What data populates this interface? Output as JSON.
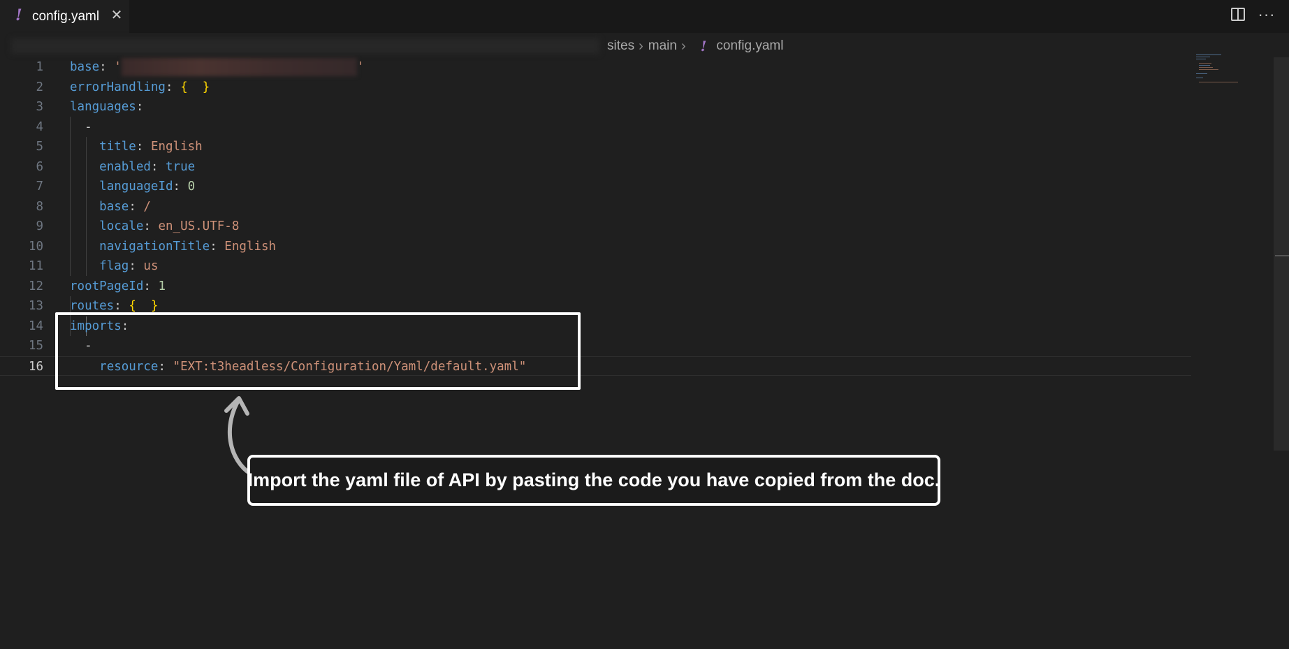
{
  "tab": {
    "icon": "yaml-file-icon",
    "label": "config.yaml",
    "close": "✕"
  },
  "toolbar": {
    "split_icon": "split-editor-icon",
    "more": "···"
  },
  "breadcrumb": {
    "items": [
      "sites",
      "main"
    ],
    "file": "config.yaml",
    "separator": "›"
  },
  "editor": {
    "active_line": 16,
    "lines": [
      {
        "num": "1"
      },
      {
        "num": "2"
      },
      {
        "num": "3"
      },
      {
        "num": "4"
      },
      {
        "num": "5"
      },
      {
        "num": "6"
      },
      {
        "num": "7"
      },
      {
        "num": "8"
      },
      {
        "num": "9"
      },
      {
        "num": "10"
      },
      {
        "num": "11"
      },
      {
        "num": "12"
      },
      {
        "num": "13"
      },
      {
        "num": "14"
      },
      {
        "num": "15"
      },
      {
        "num": "16"
      }
    ],
    "tokens": {
      "base": "base",
      "colon": ":",
      "quote": "'",
      "errorHandling": "errorHandling",
      "brace_open": "{",
      "brace_close": "}",
      "languages": "languages",
      "dash": "-",
      "title": "title",
      "title_v": "English",
      "enabled": "enabled",
      "enabled_v": "true",
      "languageId": "languageId",
      "languageId_v": "0",
      "base2_v": "/",
      "locale": "locale",
      "locale_v": "en_US.UTF-8",
      "navigationTitle": "navigationTitle",
      "navigationTitle_v": "English",
      "flag": "flag",
      "flag_v": "us",
      "rootPageId": "rootPageId",
      "rootPageId_v": "1",
      "routes": "routes",
      "imports": "imports",
      "resource": "resource",
      "resource_v": "\"EXT:t3headless/Configuration/Yaml/default.yaml\""
    }
  },
  "annotation": {
    "text": "Import the yaml file of API by pasting the code you have copied from the doc.",
    "border_color": "#ffffff"
  },
  "colors": {
    "background": "#1f1f1f",
    "key": "#569cd6",
    "string": "#ce9178",
    "number": "#b5cea8",
    "bracket": "#ffd700",
    "yaml_icon": "#a074c4"
  }
}
